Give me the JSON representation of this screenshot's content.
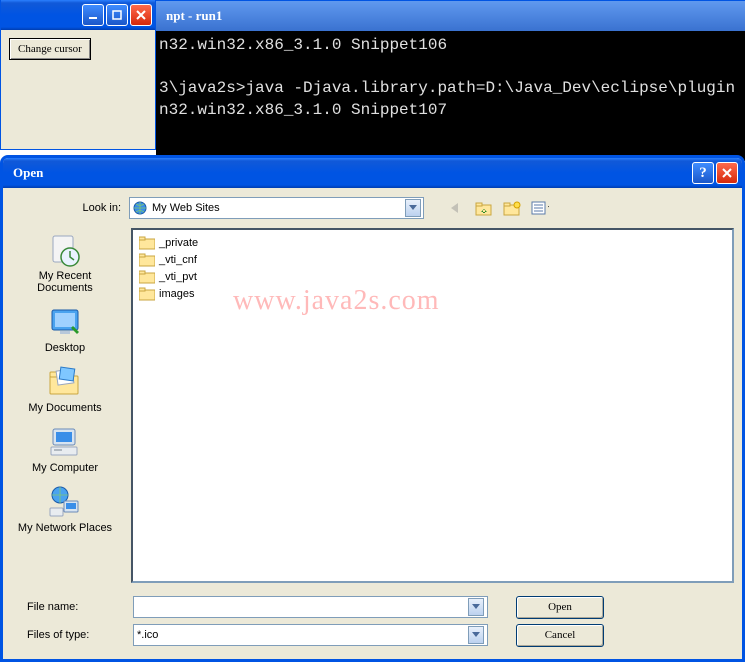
{
  "app_window": {
    "button_label": "Change cursor"
  },
  "console": {
    "title": "npt - run1",
    "line1": "n32.win32.x86_3.1.0 Snippet106",
    "line2": "",
    "line3": "3\\java2s>java -Djava.library.path=D:\\Java_Dev\\eclipse\\plugin",
    "line4": "n32.win32.x86_3.1.0 Snippet107"
  },
  "dialog": {
    "title": "Open",
    "look_in_label": "Look in:",
    "look_in_value": "My Web Sites",
    "places": {
      "recent": "My Recent Documents",
      "desktop": "Desktop",
      "mydocs": "My Documents",
      "mycomp": "My Computer",
      "network": "My Network Places"
    },
    "folders": [
      "_private",
      "_vti_cnf",
      "_vti_pvt",
      "images"
    ],
    "watermark": "www.java2s.com",
    "file_name_label": "File name:",
    "file_name_value": "",
    "file_type_label": "Files of type:",
    "file_type_value": "*.ico",
    "open_btn": "Open",
    "cancel_btn": "Cancel"
  }
}
